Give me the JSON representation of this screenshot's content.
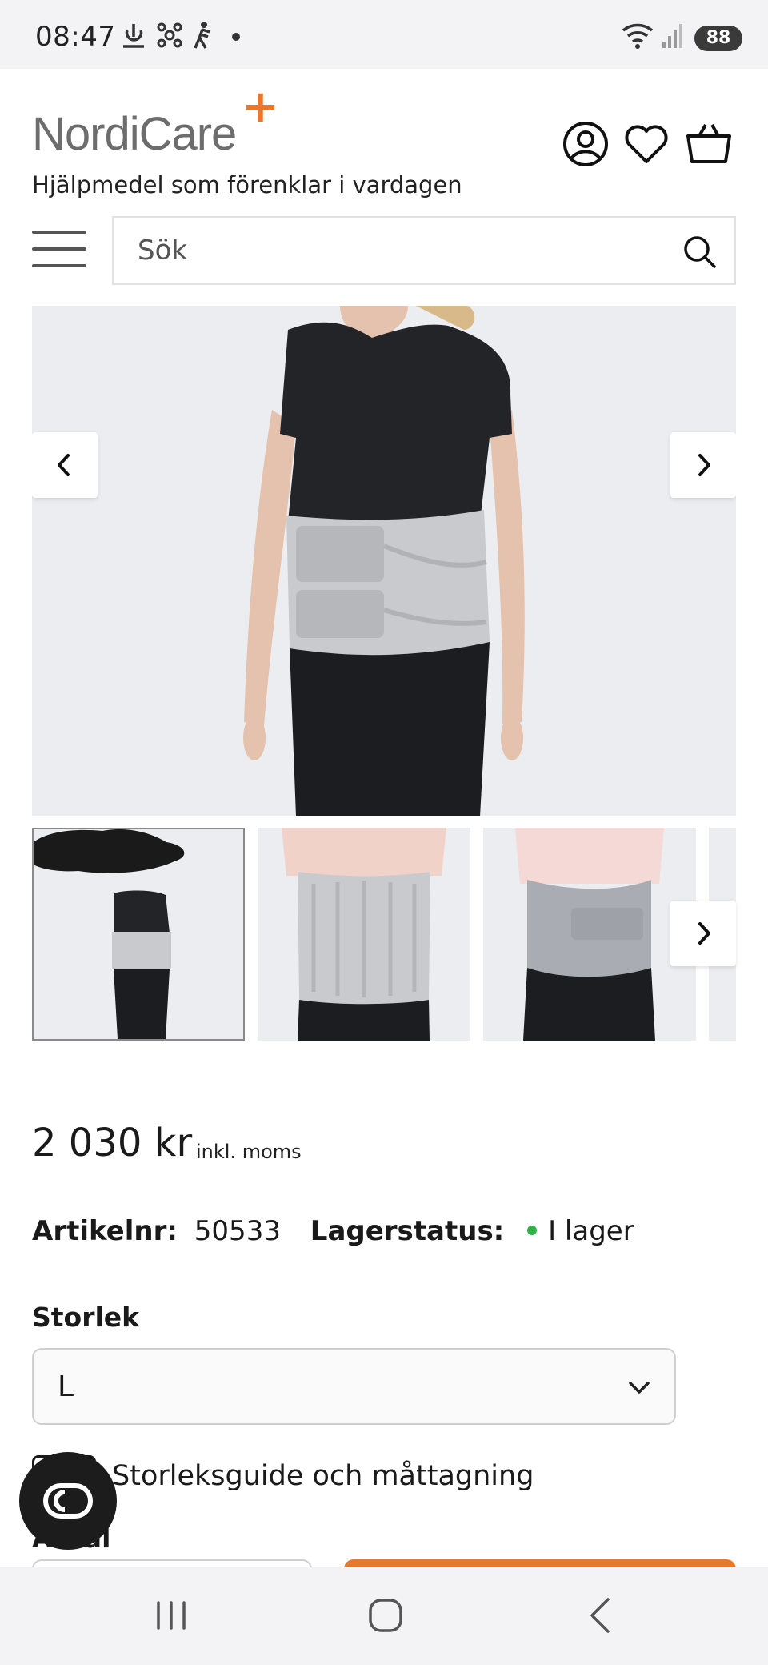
{
  "status_bar": {
    "time": "08:47",
    "battery": "88",
    "icons": [
      "data-saver-icon",
      "connected-devices-icon",
      "walking-icon",
      "dot-icon",
      "wifi-icon",
      "signal-icon"
    ]
  },
  "header": {
    "logo_text": "NordiCare",
    "logo_plus": "+",
    "tagline": "Hjälpmedel som förenklar i vardagen",
    "icons": [
      "account-icon",
      "heart-icon",
      "basket-icon"
    ]
  },
  "search": {
    "placeholder": "Sök"
  },
  "gallery": {
    "prev_icon": "chevron-left-icon",
    "next_icon": "chevron-right-icon",
    "thumbnail_count": 4
  },
  "product": {
    "price": "2 030 kr",
    "price_note": "inkl. moms",
    "sku_label": "Artikelnr:",
    "sku_value": "50533",
    "stock_label": "Lagerstatus:",
    "stock_value": "I lager",
    "stock_color": "#2fb34a",
    "size_label": "Storlek",
    "size_value": "L",
    "size_guide": "Storleksguide och måttagning",
    "partial_label": "Antal"
  },
  "colors": {
    "accent": "#e8782b",
    "logo_grey": "#6d6d6d"
  },
  "system_nav": [
    "recents-icon",
    "home-icon",
    "back-icon"
  ]
}
